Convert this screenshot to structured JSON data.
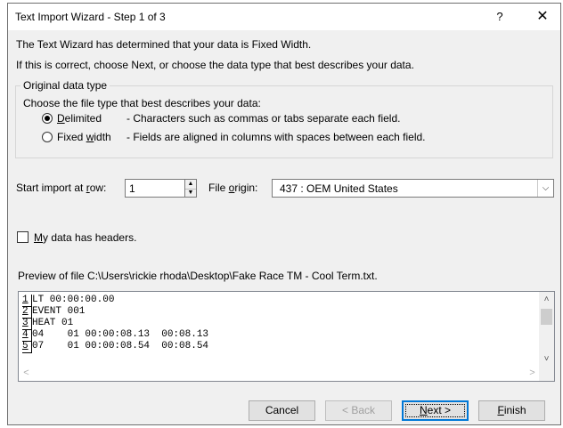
{
  "window": {
    "title": "Text Import Wizard - Step 1 of 3",
    "help": "?",
    "close": "✕"
  },
  "intro": {
    "line1": "The Text Wizard has determined that your data is Fixed Width.",
    "line2": "If this is correct, choose Next, or choose the data type that best describes your data."
  },
  "original_data_type": {
    "legend": "Original data type",
    "prompt": "Choose the file type that best describes your data:",
    "options": [
      {
        "label_pre": "",
        "label_u": "D",
        "label_post": "elimited",
        "desc": "- Characters such as commas or tabs separate each field.",
        "selected": true
      },
      {
        "label_pre": "Fixed ",
        "label_u": "w",
        "label_post": "idth",
        "desc": "- Fields are aligned in columns with spaces between each field.",
        "selected": false
      }
    ]
  },
  "start_row": {
    "label_pre": "Start import at ",
    "label_u": "r",
    "label_post": "ow:",
    "value": "1",
    "up": "▲",
    "down": "▼"
  },
  "file_origin": {
    "label_pre": "File ",
    "label_u": "o",
    "label_post": "rigin:",
    "value": "437 : OEM United States",
    "arrow": "⌵"
  },
  "headers": {
    "label_pre": "",
    "label_u": "M",
    "label_post": "y data has headers.",
    "checked": false
  },
  "preview": {
    "label": "Preview of file C:\\Users\\rickie rhoda\\Desktop\\Fake Race TM - Cool Term.txt.",
    "rows": [
      {
        "num": "1",
        "text": "LT 00:00:00.00"
      },
      {
        "num": "2",
        "text": "EVENT 001"
      },
      {
        "num": "3",
        "text": "HEAT 01"
      },
      {
        "num": "4",
        "text": "04    01 00:00:08.13  00:08.13"
      },
      {
        "num": "5",
        "text": "07    01 00:00:08.54  00:08.54"
      }
    ],
    "scroll_up": "˄",
    "scroll_down": "˅",
    "scroll_left": "<",
    "scroll_right": ">"
  },
  "buttons": {
    "cancel": "Cancel",
    "back": "< Back",
    "next_u": "N",
    "next_post": "ext >",
    "finish_u": "F",
    "finish_post": "inish"
  }
}
